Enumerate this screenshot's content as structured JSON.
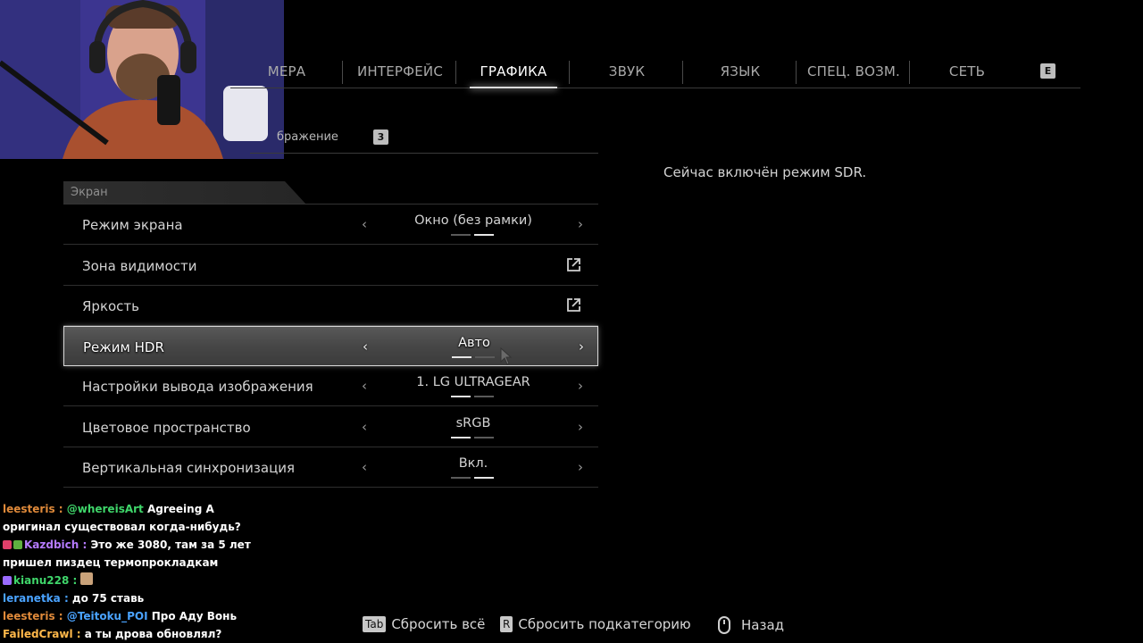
{
  "tabs": [
    {
      "label": "МЕРА",
      "active": false
    },
    {
      "label": "ИНТЕРФЕЙС",
      "active": false
    },
    {
      "label": "ГРАФИКА",
      "active": true
    },
    {
      "label": "ЗВУК",
      "active": false
    },
    {
      "label": "ЯЗЫК",
      "active": false
    },
    {
      "label": "СПЕЦ. ВОЗМ.",
      "active": false
    },
    {
      "label": "СЕТЬ",
      "active": false
    }
  ],
  "tab_next_key": "E",
  "subtab": {
    "label": "бражение",
    "key": "3"
  },
  "section": {
    "title": "Экран"
  },
  "rows": [
    {
      "label": "Режим экрана",
      "value": "Окно (без рамки)",
      "type": "selector",
      "pips_on": 2
    },
    {
      "label": "Зона видимости",
      "type": "link",
      "icon": "external-link-icon"
    },
    {
      "label": "Яркость",
      "type": "link",
      "icon": "external-link-icon"
    },
    {
      "label": "Режим HDR",
      "value": "Авто",
      "type": "selector",
      "pips_on": 1,
      "highlighted": true
    },
    {
      "label": "Настройки вывода изображения",
      "value": "1. LG ULTRAGEAR",
      "type": "selector",
      "pips_on": 1
    },
    {
      "label": "Цветовое пространство",
      "value": "sRGB",
      "type": "selector",
      "pips_on": 1
    },
    {
      "label": "Вертикальная синхронизация",
      "value": "Вкл.",
      "type": "selector",
      "pips_on": 2
    }
  ],
  "info": {
    "text": "Сейчас включён режим SDR."
  },
  "hints": {
    "reset_all_key": "Tab",
    "reset_all": "Сбросить всё",
    "reset_sub_key": "R",
    "reset_sub": "Сбросить подкатегорию",
    "back_icon": "mouse-icon",
    "back": "Назад"
  },
  "chat": [
    {
      "user": "leesteris",
      "sep": " : ",
      "mention": "@whereisArt",
      "text": " Agreeing A"
    },
    {
      "user": "",
      "sep": "",
      "mention": "",
      "text": "оригинал существовал когда-нибудь?"
    },
    {
      "user": "Kazdbich",
      "sep": " : ",
      "mention": "",
      "text": "Это же 3080, там за 5 лет"
    },
    {
      "user": "",
      "sep": "",
      "mention": "",
      "text": "пришел пиздец термопрокладкам"
    },
    {
      "user": "kianu228",
      "sep": " : ",
      "mention": "",
      "text": ""
    },
    {
      "user": "leranetka",
      "sep": " : ",
      "mention": "",
      "text": "до 75 ставь"
    },
    {
      "user": "leesteris",
      "sep": " : ",
      "mention": "@Teitoku_POI",
      "text": " Про Аду Вонь"
    },
    {
      "user": "FailedCrawl",
      "sep": " : ",
      "mention": "",
      "text": "а ты дрова обновлял?"
    }
  ],
  "colors": {
    "accent": "#ffffff",
    "bg": "#000000"
  }
}
